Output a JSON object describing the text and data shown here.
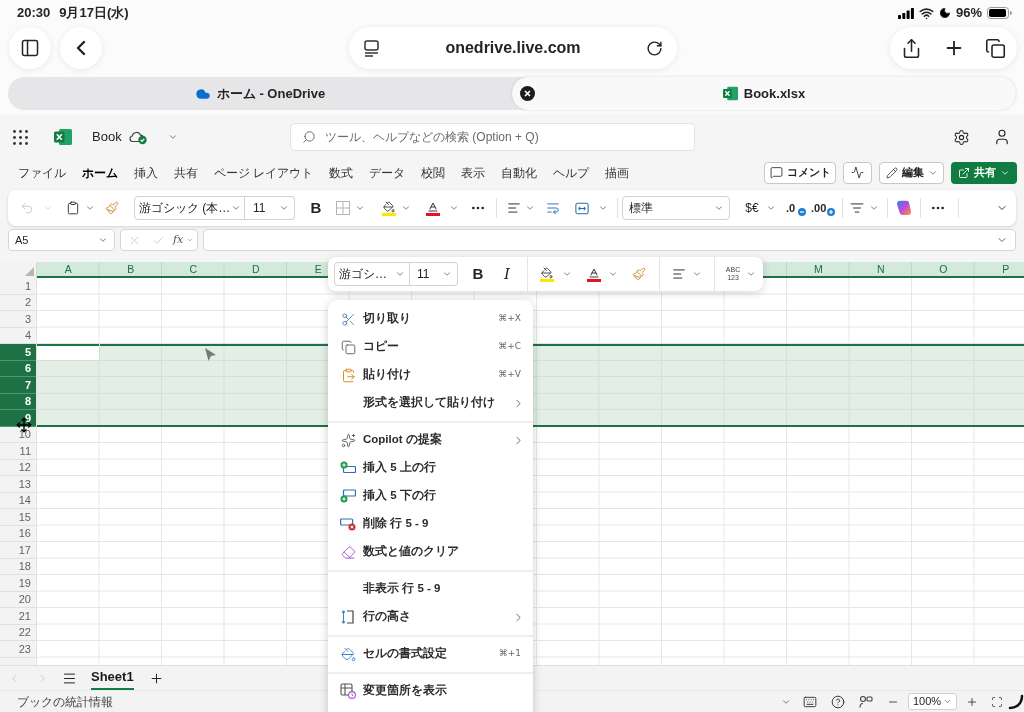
{
  "ios_status": {
    "time": "20:30",
    "date": "9月17日(水)",
    "battery": "96%"
  },
  "browser": {
    "url": "onedrive.live.com",
    "tabs": [
      {
        "kind": "onedrive",
        "title": "ホーム - OneDrive",
        "selected": false
      },
      {
        "kind": "excel",
        "title": "Book.xlsx",
        "selected": true
      }
    ]
  },
  "app_header": {
    "file_name": "Book",
    "search": {
      "placeholder": "ツール、ヘルプなどの検索 (Option + Q)"
    }
  },
  "menu_tabs": [
    {
      "label": "ファイル",
      "selected": false
    },
    {
      "label": "ホーム",
      "selected": true
    },
    {
      "label": "挿入",
      "selected": false
    },
    {
      "label": "共有",
      "selected": false
    },
    {
      "label": "ページ レイアウト",
      "selected": false
    },
    {
      "label": "数式",
      "selected": false
    },
    {
      "label": "データ",
      "selected": false
    },
    {
      "label": "校閲",
      "selected": false
    },
    {
      "label": "表示",
      "selected": false
    },
    {
      "label": "自動化",
      "selected": false
    },
    {
      "label": "ヘルプ",
      "selected": false
    },
    {
      "label": "描画",
      "selected": false
    }
  ],
  "menu_actions": [
    {
      "kind": "comment",
      "label": "コメント"
    },
    {
      "kind": "activity"
    },
    {
      "kind": "edit",
      "label": "編集"
    },
    {
      "kind": "share",
      "label": "共有"
    }
  ],
  "ribbon": {
    "undo": {
      "disabled": true
    },
    "font": "游ゴシック (本…",
    "size": "11",
    "bold": "B",
    "number_format": "標準",
    "currency": "$€",
    "decrease_decimals": ".0",
    "increase_decimals": ".00"
  },
  "formula_bar": {
    "name_box": "A5",
    "fx": "fx",
    "disabled": true
  },
  "mini_toolbar": {
    "font": "游ゴシ…",
    "size": "11",
    "bold": "B",
    "italic": "I",
    "number_format": [
      "ABC",
      "123"
    ]
  },
  "grid": {
    "column_headers": [
      "A",
      "B",
      "C",
      "D",
      "E",
      "M",
      "N",
      "O",
      "P"
    ],
    "rows": [
      {
        "label": "1",
        "selected": false,
        "active": false
      },
      {
        "label": "2",
        "selected": false,
        "active": false
      },
      {
        "label": "3",
        "selected": false,
        "active": false
      },
      {
        "label": "4",
        "selected": false,
        "active": false
      },
      {
        "label": "5",
        "selected": true,
        "active": true
      },
      {
        "label": "6",
        "selected": true,
        "active": false
      },
      {
        "label": "7",
        "selected": true,
        "active": false
      },
      {
        "label": "8",
        "selected": true,
        "active": false
      },
      {
        "label": "9",
        "selected": true,
        "active": false
      },
      {
        "label": "10",
        "selected": false,
        "active": false
      },
      {
        "label": "11",
        "selected": false,
        "active": false
      },
      {
        "label": "12",
        "selected": false,
        "active": false
      },
      {
        "label": "13",
        "selected": false,
        "active": false
      },
      {
        "label": "14",
        "selected": false,
        "active": false
      },
      {
        "label": "15",
        "selected": false,
        "active": false
      },
      {
        "label": "16",
        "selected": false,
        "active": false
      },
      {
        "label": "17",
        "selected": false,
        "active": false
      },
      {
        "label": "18",
        "selected": false,
        "active": false
      },
      {
        "label": "19",
        "selected": false,
        "active": false
      },
      {
        "label": "20",
        "selected": false,
        "active": false
      },
      {
        "label": "21",
        "selected": false,
        "active": false
      },
      {
        "label": "22",
        "selected": false,
        "active": false
      },
      {
        "label": "23",
        "selected": false,
        "active": false
      }
    ]
  },
  "context_menu": {
    "items": [
      {
        "kind": "cut",
        "label": "切り取り",
        "shortcut": "⌘+X",
        "submenu": false
      },
      {
        "kind": "copy",
        "label": "コピー",
        "shortcut": "⌘+C",
        "submenu": false
      },
      {
        "kind": "paste",
        "label": "貼り付け",
        "shortcut": "⌘+V",
        "submenu": false
      },
      {
        "kind": "paste_special",
        "label": "形式を選択して貼り付け",
        "submenu": true
      },
      {
        "kind": "separator"
      },
      {
        "kind": "copilot",
        "label": "Copilot の提案",
        "submenu": true
      },
      {
        "kind": "insert_above",
        "label": "挿入 5 上の行",
        "submenu": false
      },
      {
        "kind": "insert_below",
        "label": "挿入 5 下の行",
        "submenu": false
      },
      {
        "kind": "delete",
        "label": "削除 行 5 - 9",
        "submenu": false
      },
      {
        "kind": "clear",
        "label": "数式と値のクリア",
        "submenu": false
      },
      {
        "kind": "separator"
      },
      {
        "kind": "hide",
        "label": "非表示 行 5 - 9",
        "submenu": false
      },
      {
        "kind": "row_height",
        "label": "行の高さ",
        "submenu": true
      },
      {
        "kind": "separator"
      },
      {
        "kind": "format_cells",
        "label": "セルの書式設定",
        "shortcut": "⌘+1",
        "submenu": false
      },
      {
        "kind": "separator"
      },
      {
        "kind": "show_changes",
        "label": "変更箇所を表示",
        "submenu": false
      }
    ]
  },
  "sheet_tabs": [
    {
      "label": "Sheet1",
      "selected": true
    }
  ],
  "footer": {
    "statistics": "ブックの統計情報",
    "zoom": "100%"
  }
}
